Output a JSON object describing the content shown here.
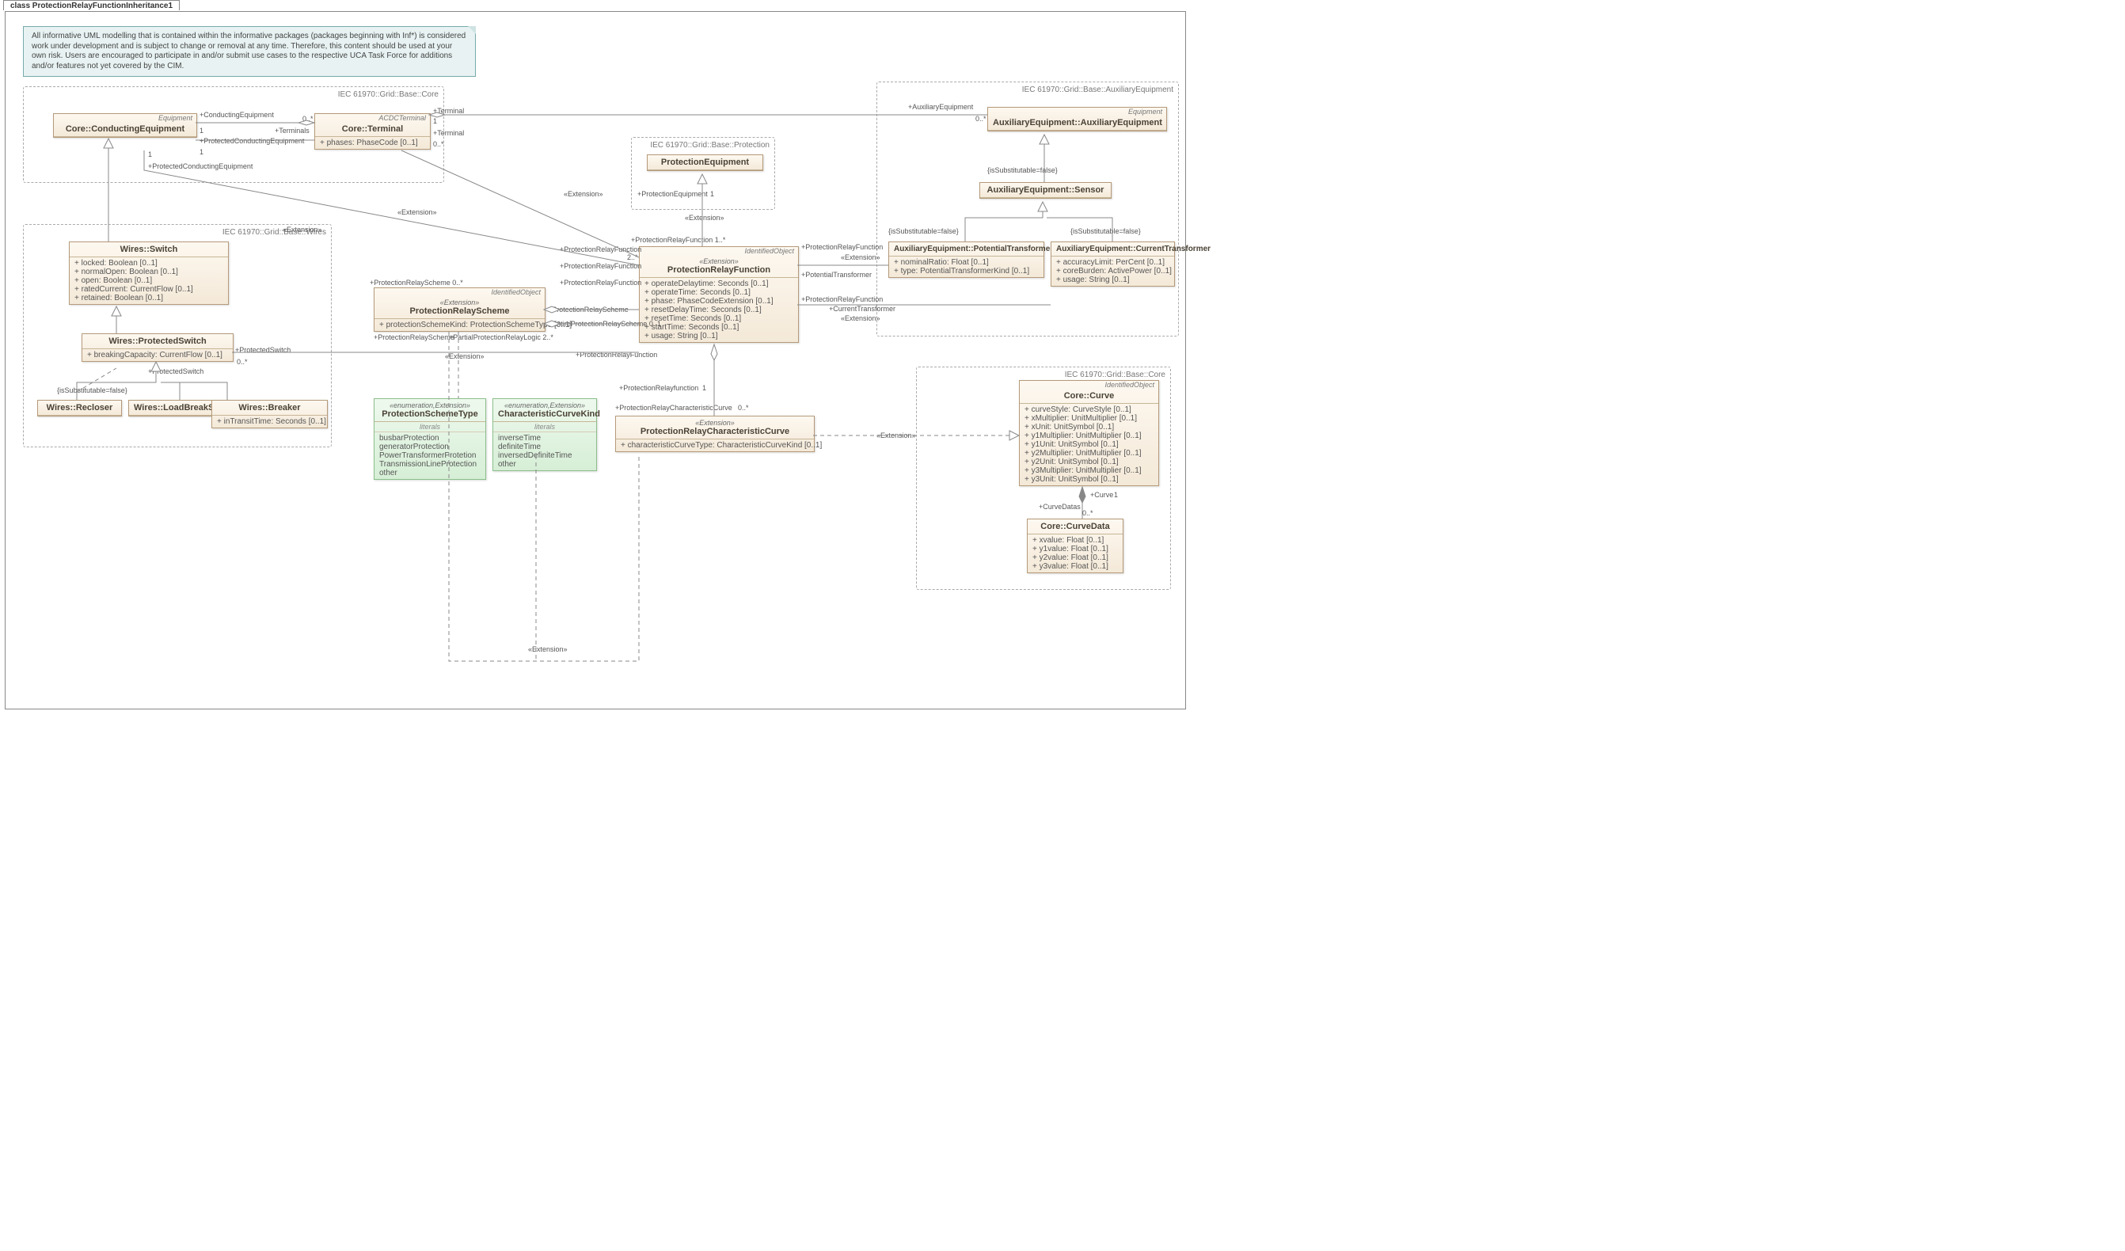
{
  "diagram": {
    "title": "class ProtectionRelayFunctionInheritance1"
  },
  "note": "All informative UML modelling that is contained within the informative packages (packages beginning with Inf*) is considered work under development and is subject to change or removal at any time.  Therefore, this content should be used at your own risk. Users are encouraged to participate in and/or submit use cases to the respective UCA Task Force for additions and/or features not yet covered by the CIM.",
  "packages": {
    "core": "IEC 61970::Grid::Base::Core",
    "wires": "IEC 61970::Grid::Base::Wires",
    "protection": "IEC 61970::Grid::Base::Protection",
    "aux": "IEC 61970::Grid::Base::AuxiliaryEquipment",
    "core2": "IEC 61970::Grid::Base::Core"
  },
  "classes": {
    "conductingEquipment": {
      "role": "Equipment",
      "name": "Core::ConductingEquipment"
    },
    "terminal": {
      "role": "ACDCTerminal",
      "name": "Core::Terminal",
      "attrs": [
        "+   phases: PhaseCode [0..1]"
      ]
    },
    "protectionEquipment": {
      "name": "ProtectionEquipment"
    },
    "auxEquipment": {
      "role": "Equipment",
      "name": "AuxiliaryEquipment::AuxiliaryEquipment"
    },
    "sensor": {
      "name": "AuxiliaryEquipment::Sensor"
    },
    "potentialTransformer": {
      "name": "AuxiliaryEquipment::PotentialTransformer",
      "attrs": [
        "+   nominalRatio: Float [0..1]",
        "+   type: PotentialTransformerKind [0..1]"
      ]
    },
    "currentTransformer": {
      "name": "AuxiliaryEquipment::CurrentTransformer",
      "attrs": [
        "+   accuracyLimit: PerCent [0..1]",
        "+   coreBurden: ActivePower [0..1]",
        "+   usage: String [0..1]"
      ]
    },
    "switch": {
      "name": "Wires::Switch",
      "attrs": [
        "+   locked: Boolean [0..1]",
        "+   normalOpen: Boolean [0..1]",
        "+   open: Boolean [0..1]",
        "+   ratedCurrent: CurrentFlow [0..1]",
        "+   retained: Boolean [0..1]"
      ]
    },
    "protectedSwitch": {
      "name": "Wires::ProtectedSwitch",
      "attrs": [
        "+   breakingCapacity: CurrentFlow [0..1]"
      ]
    },
    "recloser": {
      "name": "Wires::Recloser"
    },
    "loadBreakSwitch": {
      "name": "Wires::LoadBreakSwitch"
    },
    "breaker": {
      "name": "Wires::Breaker",
      "attrs": [
        "+   inTransitTime: Seconds [0..1]"
      ]
    },
    "relayScheme": {
      "role": "IdentifiedObject",
      "stereo": "«Extension»",
      "name": "ProtectionRelayScheme",
      "attrs": [
        "+   protectionSchemeKind: ProtectionSchemeType [0..1]"
      ]
    },
    "relayFunction": {
      "role": "IdentifiedObject",
      "stereo": "«Extension»",
      "name": "ProtectionRelayFunction",
      "attrs": [
        "+   operateDelaytime: Seconds [0..1]",
        "+   operateTime: Seconds [0..1]",
        "+   phase: PhaseCodeExtension [0..1]",
        "+   resetDelayTime: Seconds [0..1]",
        "+   resetTime: Seconds [0..1]",
        "+   startTime: Seconds [0..1]",
        "+   usage: String [0..1]"
      ]
    },
    "charCurve": {
      "stereo": "«Extension»",
      "name": "ProtectionRelayCharacteristicCurve",
      "attrs": [
        "+   characteristicCurveType: CharacteristicCurveKind [0..1]"
      ]
    },
    "schemeTypeEnum": {
      "stereo": "«enumeration,Extension»",
      "name": "ProtectionSchemeType",
      "literalsHeader": "literals",
      "literals": [
        "busbarProtection",
        "generatorProtection",
        "PowerTransformerProtetion",
        "TransmissionLineProtection",
        "other"
      ]
    },
    "curveKindEnum": {
      "stereo": "«enumeration,Extension»",
      "name": "CharacteristicCurveKind",
      "literalsHeader": "literals",
      "literals": [
        "inverseTime",
        "definiteTime",
        "inversedDefiniteTime",
        "other"
      ]
    },
    "curve": {
      "role": "IdentifiedObject",
      "name": "Core::Curve",
      "attrs": [
        "+   curveStyle: CurveStyle [0..1]",
        "+   xMultiplier: UnitMultiplier [0..1]",
        "+   xUnit: UnitSymbol [0..1]",
        "+   y1Multiplier: UnitMultiplier [0..1]",
        "+   y1Unit: UnitSymbol [0..1]",
        "+   y2Multiplier: UnitMultiplier [0..1]",
        "+   y2Unit: UnitSymbol [0..1]",
        "+   y3Multiplier: UnitMultiplier [0..1]",
        "+   y3Unit: UnitSymbol [0..1]"
      ]
    },
    "curveData": {
      "name": "Core::CurveData",
      "attrs": [
        "+   xvalue: Float [0..1]",
        "+   y1value: Float [0..1]",
        "+   y2value: Float [0..1]",
        "+   y3value: Float [0..1]"
      ]
    }
  },
  "labels": {
    "condEq": "+ConductingEquipment",
    "one": "1",
    "terminals": "+Terminals",
    "zeroStar": "0..*",
    "terminal": "+Terminal",
    "protCondEq": "+ProtectedConductingEquipment",
    "ext": "«Extension»",
    "protEq": "+ProtectionEquipment",
    "auxEq": "+AuxiliaryEquipment",
    "isSubFalse": "{isSubstitutable=false}",
    "prf": "+ProtectionRelayFunction",
    "prf1star": "+ProtectionRelayFunction 1..*",
    "prs": "+ProtectionRelayScheme",
    "prs0": "+ProtectionRelayScheme 0..*",
    "twoStar": "2..*",
    "zeroOne": "0..1",
    "entire": "+EntireProtectionRelayScheme 0..1",
    "partial": "+PartialProtectionRelayLogic 2..*",
    "protSwitch": "+ProtectedSwitch",
    "prfLow": "+ProtectionRelayfunction",
    "charCurve": "+ProtectionRelayCharacteristicCurve",
    "pt": "+PotentialTransformer",
    "ct": "+CurrentTransformer",
    "curveR": "+Curve",
    "curveDatas": "+CurveDatas"
  }
}
